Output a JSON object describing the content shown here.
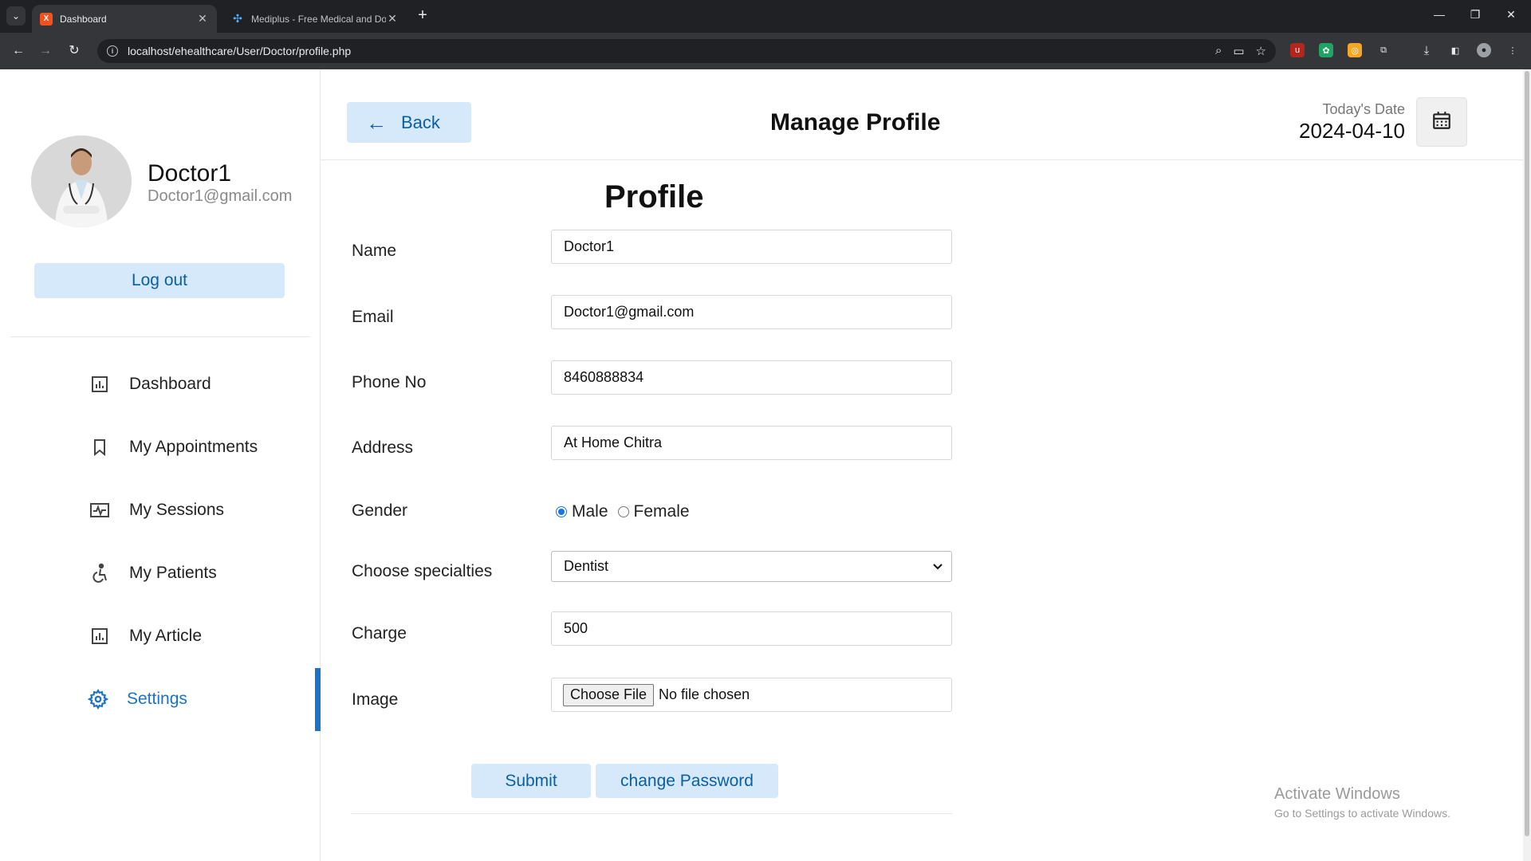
{
  "browser": {
    "tabs": [
      {
        "title": "Dashboard",
        "active": true
      },
      {
        "title": "Mediplus - Free Medical and Do",
        "active": false
      }
    ],
    "url": "localhost/ehealthcare/User/Doctor/profile.php"
  },
  "sidebar": {
    "user_name": "Doctor1",
    "user_email": "Doctor1@gmail.com",
    "logout_label": "Log out",
    "items": [
      {
        "label": "Dashboard",
        "icon": "chart-icon"
      },
      {
        "label": "My Appointments",
        "icon": "bookmark-icon"
      },
      {
        "label": "My Sessions",
        "icon": "pulse-icon"
      },
      {
        "label": "My Patients",
        "icon": "accessibility-icon"
      },
      {
        "label": "My Article",
        "icon": "chart-icon"
      },
      {
        "label": "Settings",
        "icon": "gear-icon",
        "active": true
      }
    ]
  },
  "header": {
    "back_label": "Back",
    "title": "Manage Profile",
    "date_label": "Today's Date",
    "date_value": "2024-04-10"
  },
  "form": {
    "title": "Profile",
    "name_label": "Name",
    "name_value": "Doctor1",
    "email_label": "Email",
    "email_value": "Doctor1@gmail.com",
    "phone_label": "Phone No",
    "phone_value": "8460888834",
    "address_label": "Address",
    "address_value": "At Home Chitra",
    "gender_label": "Gender",
    "gender_male": "Male",
    "gender_female": "Female",
    "gender_selected": "Male",
    "specialty_label": "Choose specialties",
    "specialty_value": "Dentist",
    "charge_label": "Charge",
    "charge_value": "500",
    "image_label": "Image",
    "file_button": "Choose File",
    "file_status": "No file chosen",
    "submit_label": "Submit",
    "change_password_label": "change Password"
  },
  "watermark": {
    "line1": "Activate Windows",
    "line2": "Go to Settings to activate Windows."
  },
  "colors": {
    "accent": "#1a73c8",
    "button_bg": "#d6e9fb",
    "button_text": "#0b5fa5"
  }
}
